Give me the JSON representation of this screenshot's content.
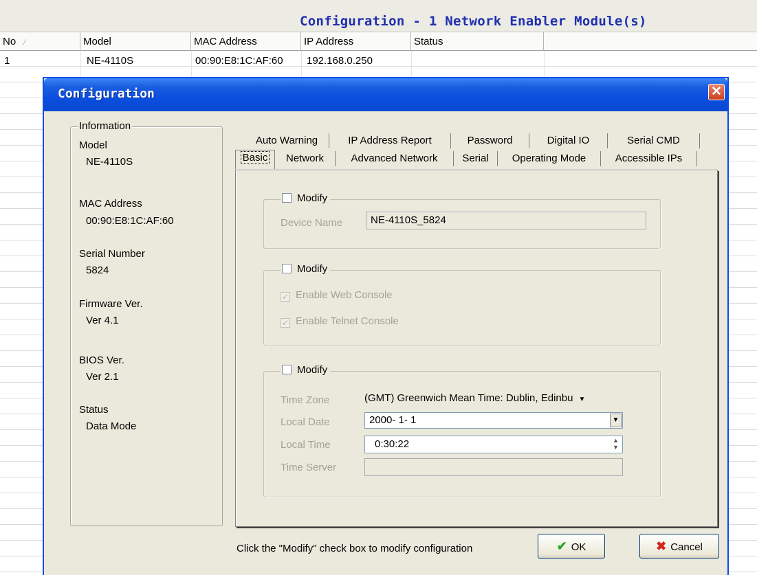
{
  "window": {
    "title": "Configuration - 1 Network Enabler Module(s)"
  },
  "grid": {
    "columns": [
      "No",
      "Model",
      "MAC Address",
      "IP Address",
      "Status"
    ],
    "rows": [
      {
        "no": "1",
        "model": "NE-4110S",
        "mac": "00:90:E8:1C:AF:60",
        "ip": "192.168.0.250",
        "status": ""
      }
    ]
  },
  "dialog": {
    "title": "Configuration",
    "info": {
      "legend": "Information",
      "model_label": "Model",
      "model_value": "NE-4110S",
      "mac_label": "MAC Address",
      "mac_value": "00:90:E8:1C:AF:60",
      "serial_label": "Serial Number",
      "serial_value": "5824",
      "firmware_label": "Firmware Ver.",
      "firmware_value": "Ver 4.1",
      "bios_label": "BIOS Ver.",
      "bios_value": "Ver 2.1",
      "status_label": "Status",
      "status_value": "Data Mode"
    },
    "tabs_back": [
      "Auto Warning",
      "IP Address Report",
      "Password",
      "Digital IO",
      "Serial CMD"
    ],
    "tabs_front": [
      "Basic",
      "Network",
      "Advanced Network",
      "Serial",
      "Operating Mode",
      "Accessible IPs"
    ],
    "active_tab": "Basic",
    "basic": {
      "group1": {
        "modify": "Modify",
        "device_name_label": "Device Name",
        "device_name_value": "NE-4110S_5824"
      },
      "group2": {
        "modify": "Modify",
        "web_console": "Enable Web Console",
        "telnet_console": "Enable Telnet Console"
      },
      "group3": {
        "modify": "Modify",
        "time_zone_label": "Time Zone",
        "time_zone_value": "(GMT) Greenwich Mean Time: Dublin, Edinbu",
        "local_date_label": "Local Date",
        "local_date_value": "2000- 1- 1",
        "local_time_label": "Local Time",
        "local_time_value": "0:30:22",
        "time_server_label": "Time Server",
        "time_server_value": ""
      }
    },
    "footer": {
      "hint": "Click the \"Modify\" check box to modify configuration",
      "ok_label": "OK",
      "cancel_label": "Cancel"
    }
  }
}
